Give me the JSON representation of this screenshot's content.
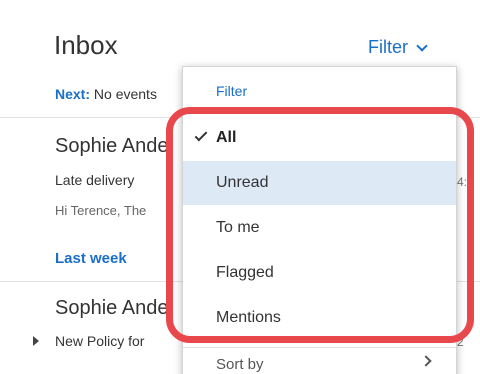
{
  "inbox": {
    "title": "Inbox",
    "filter_label": "Filter",
    "next_label": "Next:",
    "next_text": "No events",
    "section_last_week": "Last week"
  },
  "messages": [
    {
      "sender": "Sophie Ande",
      "subject": "Late delivery",
      "preview": "Hi Terence,   The",
      "edge": "4:"
    },
    {
      "sender": "Sophie Ande",
      "subject": "New Policy for",
      "preview": "",
      "edge": "2"
    }
  ],
  "filter_menu": {
    "header": "Filter",
    "items": [
      {
        "label": "All",
        "selected": true
      },
      {
        "label": "Unread",
        "selected": false
      },
      {
        "label": "To me",
        "selected": false
      },
      {
        "label": "Flagged",
        "selected": false
      },
      {
        "label": "Mentions",
        "selected": false
      }
    ],
    "sort_label": "Sort by"
  },
  "colors": {
    "accent": "#1a6fc8",
    "hover": "#dde9f5",
    "annotation": "#e8474c"
  }
}
